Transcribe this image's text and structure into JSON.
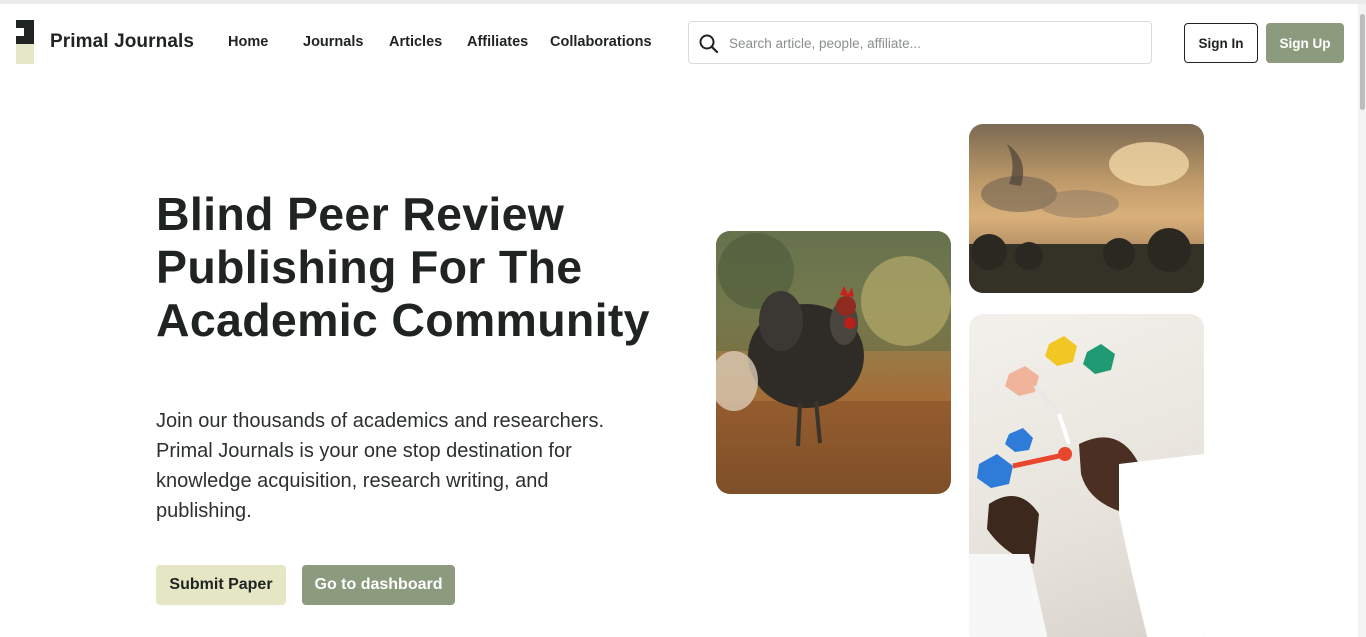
{
  "header": {
    "brand": "Primal Journals",
    "nav": [
      "Home",
      "Journals",
      "Articles",
      "Affiliates",
      "Collaborations"
    ],
    "search_placeholder": "Search article, people, affiliate...",
    "signin_label": "Sign In",
    "signup_label": "Sign Up"
  },
  "hero": {
    "title": "Blind Peer Review Publishing For The Academic Community",
    "description": "Join our thousands of academics and researchers. Primal Journals is your one stop destination for knowledge acquisition, research writing, and publishing.",
    "submit_label": "Submit Paper",
    "dashboard_label": "Go to dashboard"
  },
  "colors": {
    "accent": "#8c9a7d",
    "accent_light": "#e4e6c4",
    "text_dark": "#1f2322"
  }
}
